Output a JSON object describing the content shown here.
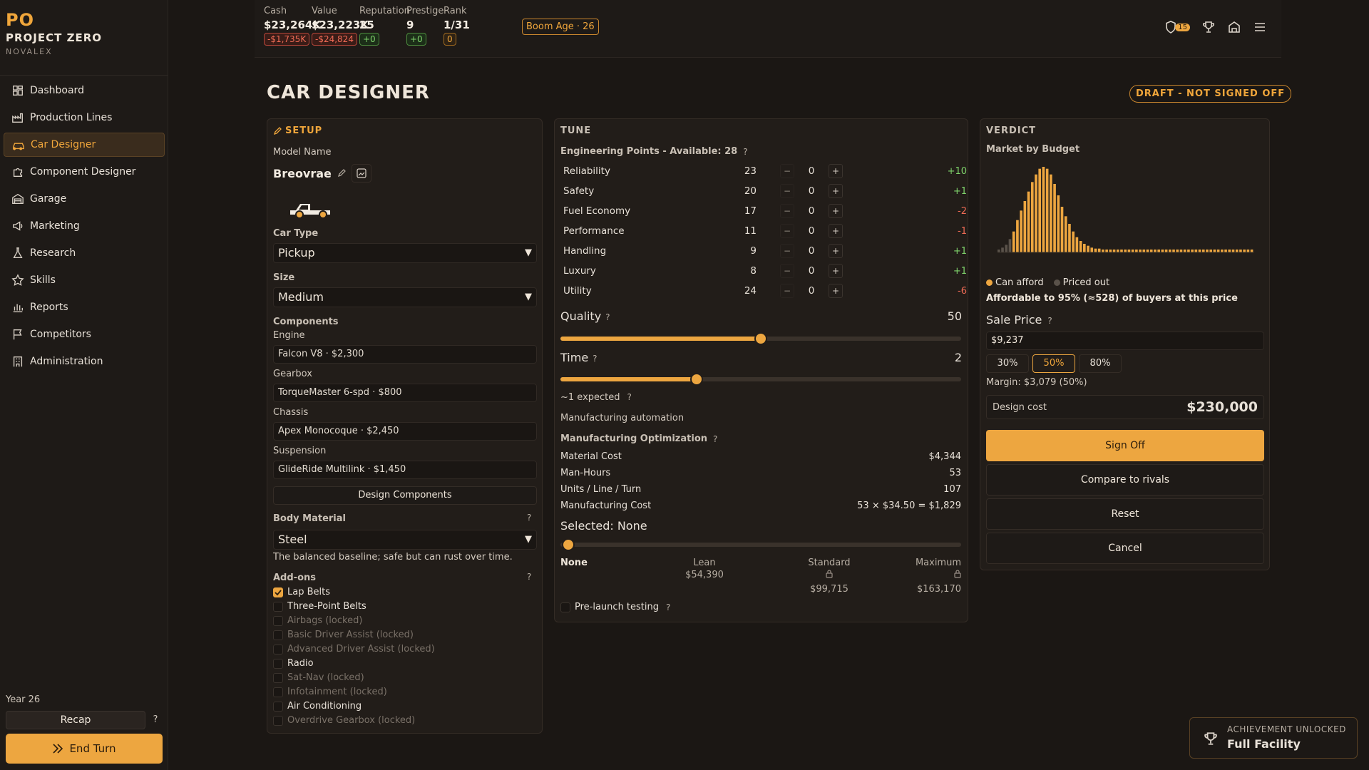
{
  "app": {
    "mark": "PO",
    "name": "PROJECT ZERO",
    "company": "NOVALEX"
  },
  "sidebar": {
    "items": [
      {
        "label": "Dashboard",
        "icon": "dashboard-icon"
      },
      {
        "label": "Production Lines",
        "icon": "factory-icon"
      },
      {
        "label": "Car Designer",
        "icon": "car-icon",
        "active": true
      },
      {
        "label": "Component Designer",
        "icon": "puzzle-icon"
      },
      {
        "label": "Garage",
        "icon": "garage-icon"
      },
      {
        "label": "Marketing",
        "icon": "megaphone-icon"
      },
      {
        "label": "Research",
        "icon": "flask-icon"
      },
      {
        "label": "Skills",
        "icon": "star-icon"
      },
      {
        "label": "Reports",
        "icon": "bar-chart-icon"
      },
      {
        "label": "Competitors",
        "icon": "flag-icon"
      },
      {
        "label": "Administration",
        "icon": "building-icon"
      }
    ],
    "year": "Year 26",
    "recap": "Recap",
    "help": "?",
    "end_turn": "End Turn"
  },
  "topbar": {
    "stats": [
      {
        "label": "Cash",
        "value": "$23,264K",
        "delta": "-$1,735K",
        "tone": "neg"
      },
      {
        "label": "Value",
        "value": "$23,223K",
        "delta": "-$24,824",
        "tone": "neg"
      },
      {
        "label": "Reputation",
        "value": "25",
        "delta": "+0",
        "tone": "pos"
      },
      {
        "label": "Prestige",
        "value": "9",
        "delta": "+0",
        "tone": "pos"
      },
      {
        "label": "Rank",
        "value": "1/31",
        "delta": "0",
        "tone": "neu"
      }
    ],
    "era": "Boom Age · 26",
    "badge_count": "15"
  },
  "page": {
    "title": "CAR DESIGNER",
    "status": "DRAFT - NOT SIGNED OFF"
  },
  "setup": {
    "heading": "SETUP",
    "model_name_label": "Model Name",
    "model_name": "Breovrae",
    "car_type_label": "Car Type",
    "car_type": "Pickup",
    "size_label": "Size",
    "size": "Medium",
    "components_label": "Components",
    "components": [
      {
        "label": "Engine",
        "value": "Falcon V8 · $2,300"
      },
      {
        "label": "Gearbox",
        "value": "TorqueMaster 6-spd · $800"
      },
      {
        "label": "Chassis",
        "value": "Apex Monocoque · $2,450"
      },
      {
        "label": "Suspension",
        "value": "GlideRide Multilink · $1,450"
      }
    ],
    "design_components": "Design Components",
    "body_material_label": "Body Material",
    "body_material": "Steel",
    "body_material_desc": "The balanced baseline; safe but can rust over time.",
    "addons_label": "Add-ons",
    "addons": [
      {
        "label": "Lap Belts",
        "checked": true,
        "locked": false
      },
      {
        "label": "Three-Point Belts",
        "checked": false,
        "locked": false
      },
      {
        "label": "Airbags (locked)",
        "checked": false,
        "locked": true
      },
      {
        "label": "Basic Driver Assist (locked)",
        "checked": false,
        "locked": true
      },
      {
        "label": "Advanced Driver Assist (locked)",
        "checked": false,
        "locked": true
      },
      {
        "label": "Radio",
        "checked": false,
        "locked": false
      },
      {
        "label": "Sat-Nav (locked)",
        "checked": false,
        "locked": true
      },
      {
        "label": "Infotainment (locked)",
        "checked": false,
        "locked": true
      },
      {
        "label": "Air Conditioning",
        "checked": false,
        "locked": false
      },
      {
        "label": "Overdrive Gearbox (locked)",
        "checked": false,
        "locked": true
      }
    ]
  },
  "tune": {
    "heading": "TUNE",
    "points_label": "Engineering Points - Available: 28",
    "attributes": [
      {
        "name": "Reliability",
        "value": "23",
        "alloc": "0",
        "delta": "+10",
        "tone": "green"
      },
      {
        "name": "Safety",
        "value": "20",
        "alloc": "0",
        "delta": "+1",
        "tone": "green"
      },
      {
        "name": "Fuel Economy",
        "value": "17",
        "alloc": "0",
        "delta": "-2",
        "tone": "red"
      },
      {
        "name": "Performance",
        "value": "11",
        "alloc": "0",
        "delta": "-1",
        "tone": "red"
      },
      {
        "name": "Handling",
        "value": "9",
        "alloc": "0",
        "delta": "+1",
        "tone": "green"
      },
      {
        "name": "Luxury",
        "value": "8",
        "alloc": "0",
        "delta": "+1",
        "tone": "green"
      },
      {
        "name": "Utility",
        "value": "24",
        "alloc": "0",
        "delta": "-6",
        "tone": "red"
      }
    ],
    "minus": "−",
    "plus": "+",
    "quality_label": "Quality",
    "quality_value": "50",
    "quality_fraction": 0.5,
    "time_label": "Time",
    "time_value": "2",
    "time_fraction": 0.34,
    "expected": "~1 expected",
    "automation": "Manufacturing automation",
    "optimization_label": "Manufacturing Optimization",
    "metrics": [
      {
        "label": "Material Cost",
        "value": "$4,344"
      },
      {
        "label": "Man-Hours",
        "value": "53"
      },
      {
        "label": "Units / Line / Turn",
        "value": "107"
      },
      {
        "label": "Manufacturing Cost",
        "value": "53 × $34.50 = $1,829"
      }
    ],
    "selected": "Selected: None",
    "tiers": [
      {
        "name": "None",
        "price": ""
      },
      {
        "name": "Lean",
        "price": "$54,390"
      },
      {
        "name": "Standard",
        "price": "$99,715"
      },
      {
        "name": "Maximum",
        "price": "$163,170"
      }
    ],
    "prelaunch": "Pre-launch testing"
  },
  "verdict": {
    "heading": "VERDICT",
    "market_label": "Market by Budget",
    "legend_afford": "Can afford",
    "legend_priced": "Priced out",
    "affordable": "Affordable to 95% (≈528) of buyers at this price",
    "sale_price_label": "Sale Price",
    "sale_price": "$9,237",
    "pct_options": [
      "30%",
      "50%",
      "80%"
    ],
    "pct_selected": "50%",
    "margin": "Margin: $3,079 (50%)",
    "design_cost_label": "Design cost",
    "design_cost": "$230,000",
    "sign_off": "Sign Off",
    "compare": "Compare to rivals",
    "reset": "Reset",
    "cancel": "Cancel"
  },
  "chart_data": {
    "type": "bar",
    "title": "Market by Budget",
    "values": [
      3,
      5,
      8,
      14,
      22,
      34,
      44,
      54,
      64,
      74,
      82,
      88,
      90,
      88,
      82,
      72,
      60,
      48,
      38,
      30,
      22,
      16,
      12,
      9,
      7,
      5,
      4,
      4,
      3,
      3,
      3,
      3,
      3,
      3,
      3,
      3,
      3,
      3,
      3,
      3,
      3,
      3,
      3,
      3,
      3,
      3,
      3,
      3,
      3,
      3,
      3,
      3,
      3,
      3,
      3,
      3,
      3,
      3,
      3,
      3,
      3,
      3,
      3,
      3,
      3,
      3,
      3,
      3,
      3
    ],
    "afford_from_index": 4,
    "colors": {
      "afford": "#eda640",
      "priced_out": "#5a524a"
    }
  },
  "toast": {
    "kicker": "ACHIEVEMENT UNLOCKED",
    "title": "Full Facility"
  }
}
